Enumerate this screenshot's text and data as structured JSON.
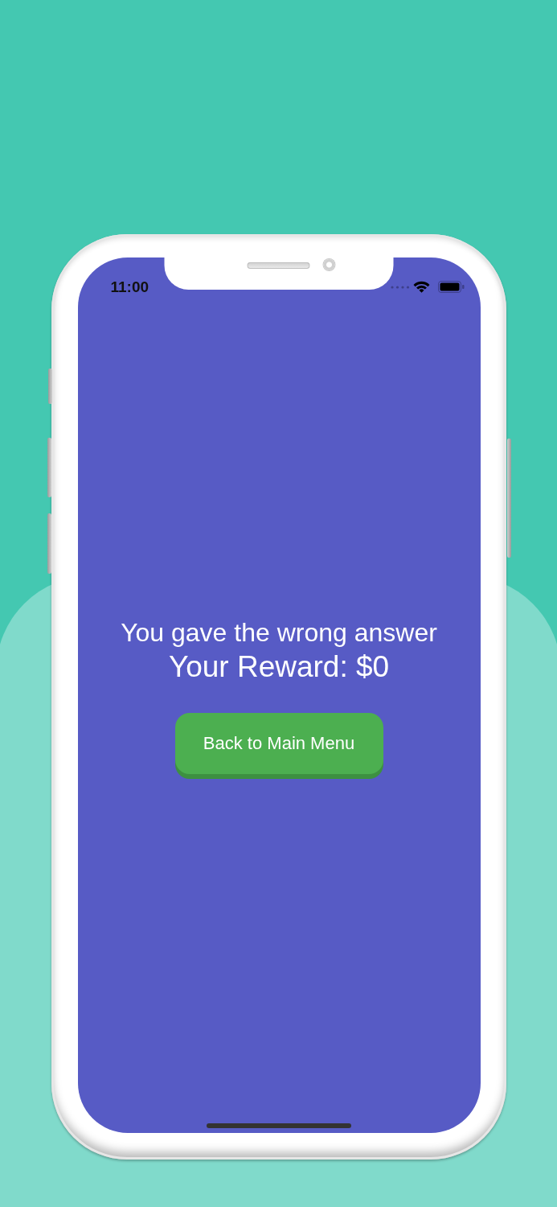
{
  "status_bar": {
    "time": "11:00"
  },
  "message": {
    "title": "You gave the wrong answer",
    "reward": "Your Reward: $0"
  },
  "button": {
    "label": "Back to Main Menu"
  }
}
